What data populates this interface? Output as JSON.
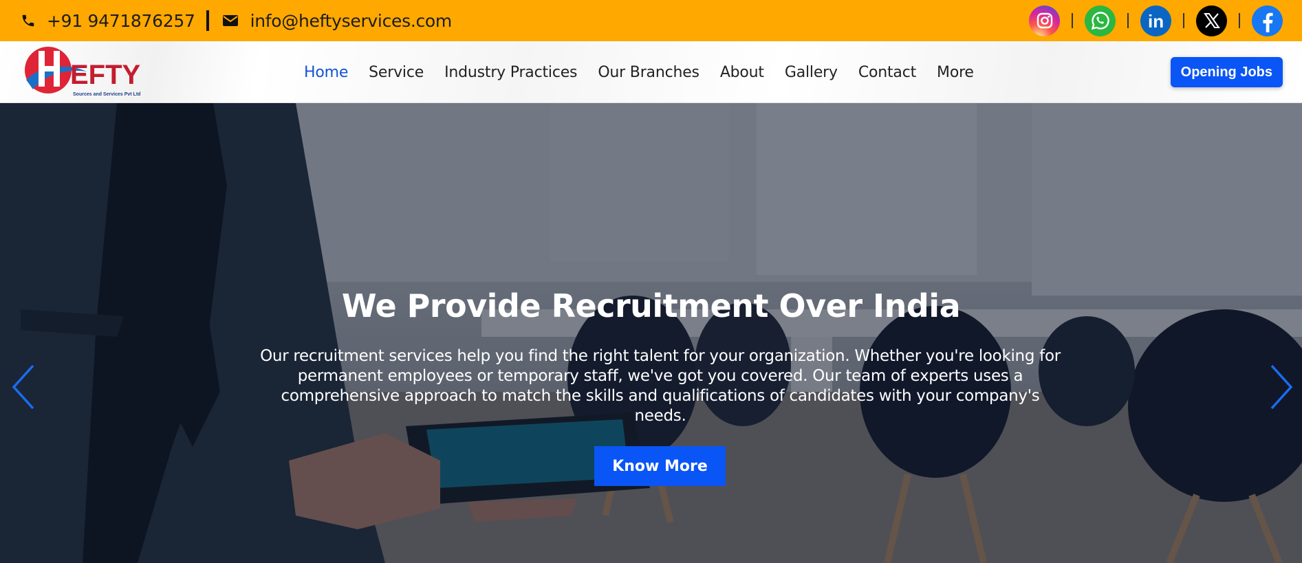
{
  "topbar": {
    "phone": "+91 9471876257",
    "email": "info@heftyservices.com",
    "icons": {
      "phone": "phone-icon",
      "email": "envelope-icon"
    },
    "social": [
      {
        "name": "instagram-icon",
        "color": "#d6249f"
      },
      {
        "name": "whatsapp-icon",
        "color": "#2BB741"
      },
      {
        "name": "linkedin-icon",
        "color": "#0A66C2"
      },
      {
        "name": "x-twitter-icon",
        "color": "#000000"
      },
      {
        "name": "facebook-icon",
        "color": "#1877F2"
      }
    ],
    "social_labels": {
      "linkedin": "in"
    },
    "background": "#FFA800"
  },
  "logo": {
    "wordmark": "EFTY",
    "tagline": "Sources and Services Pvt Ltd"
  },
  "nav": {
    "items": [
      "Home",
      "Service",
      "Industry Practices",
      "Our Branches",
      "About",
      "Gallery",
      "Contact",
      "More"
    ],
    "active": "Home",
    "active_color": "#1252d4"
  },
  "header": {
    "cta_label": "Opening Jobs",
    "cta_color": "#0a55f5"
  },
  "hero": {
    "title": "We Provide Recruitment Over India",
    "description": "Our recruitment services help you find the right talent for your organization. Whether you're looking for permanent employees or temporary staff, we've got you covered. Our team of experts uses a comprehensive approach to match the skills and qualifications of candidates with your company's needs.",
    "button_label": "Know More",
    "prev_icon": "chevron-left-icon",
    "next_icon": "chevron-right-icon",
    "arrow_color": "#1a6cf0"
  }
}
